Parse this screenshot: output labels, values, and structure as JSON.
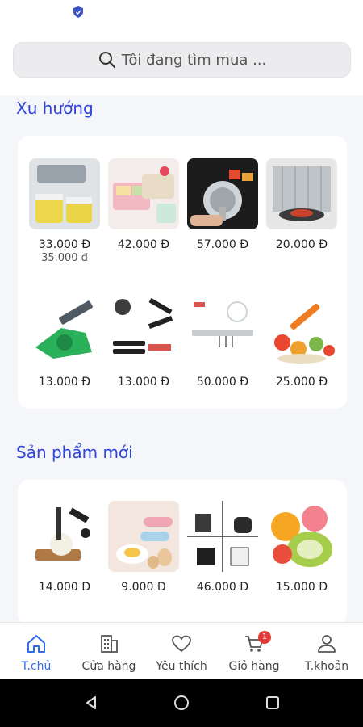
{
  "search": {
    "placeholder": "Tôi đang tìm mua ..."
  },
  "sections": {
    "trending": {
      "title": "Xu hướng",
      "products": [
        {
          "price": "33.000 Đ",
          "old_price": "35.000 đ"
        },
        {
          "price": "42.000 Đ"
        },
        {
          "price": "57.000 Đ"
        },
        {
          "price": "20.000 Đ"
        },
        {
          "price": "13.000 Đ"
        },
        {
          "price": "13.000 Đ"
        },
        {
          "price": "50.000 Đ"
        },
        {
          "price": "25.000 Đ"
        }
      ]
    },
    "new_products": {
      "title": "Sản phẩm mới",
      "products": [
        {
          "price": "14.000 Đ"
        },
        {
          "price": "9.000 Đ"
        },
        {
          "price": "46.000 Đ"
        },
        {
          "price": "15.000 Đ"
        }
      ]
    }
  },
  "bottom_nav": {
    "items": [
      {
        "label": "T.chủ",
        "icon": "home-icon",
        "active": true
      },
      {
        "label": "Cửa hàng",
        "icon": "building-icon"
      },
      {
        "label": "Yêu thích",
        "icon": "heart-icon"
      },
      {
        "label": "Giỏ hàng",
        "icon": "cart-icon",
        "badge": "1"
      },
      {
        "label": "T.khoản",
        "icon": "user-icon"
      }
    ]
  },
  "colors": {
    "accent": "#2f45d9",
    "active_nav": "#2f6df0",
    "badge": "#e53935"
  }
}
